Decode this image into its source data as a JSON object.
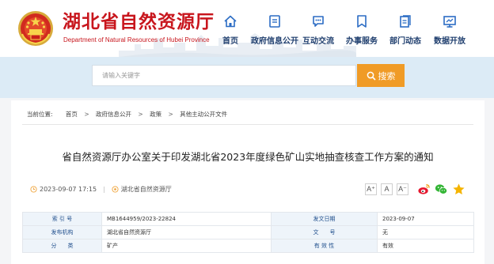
{
  "site": {
    "title": "湖北省自然资源厅",
    "subtitle": "Department of Natural Resources of Hubei Province"
  },
  "nav": [
    {
      "label": "首页",
      "icon": "home-icon"
    },
    {
      "label": "政府信息公开",
      "icon": "document-icon"
    },
    {
      "label": "互动交流",
      "icon": "chat-icon"
    },
    {
      "label": "办事服务",
      "icon": "bookmark-icon"
    },
    {
      "label": "部门动态",
      "icon": "news-icon"
    },
    {
      "label": "数据开放",
      "icon": "monitor-icon"
    }
  ],
  "search": {
    "placeholder": "请输入关键字",
    "button_label": "搜索"
  },
  "breadcrumb": {
    "prefix": "当前位置:",
    "items": [
      "首页",
      "政府信息公开",
      "政策",
      "其他主动公开文件"
    ]
  },
  "article": {
    "title": "省自然资源厅办公室关于印发湖北省2023年度绿色矿山实地抽查核查工作方案的通知",
    "datetime": "2023-09-07 17:15",
    "source": "湖北省自然资源厅"
  },
  "font_sizes": [
    "A⁺",
    "A",
    "A⁻"
  ],
  "share": [
    "weibo-icon",
    "wechat-icon",
    "favorite-star-icon"
  ],
  "info": {
    "rows": [
      [
        {
          "label": "索 引 号",
          "value": "MB1644959/2023-22824"
        },
        {
          "label": "发文日期",
          "value": "2023-09-07"
        }
      ],
      [
        {
          "label": "发布机构",
          "value": "湖北省自然资源厅"
        },
        {
          "label": "文　　号",
          "value": "无"
        }
      ],
      [
        {
          "label": "分　　类",
          "value": "矿产"
        },
        {
          "label": "有 效 性",
          "value": "有效"
        }
      ]
    ]
  },
  "colors": {
    "brand_red": "#c8161d",
    "nav_blue": "#1f3e6e",
    "search_orange": "#f09b26",
    "band_blue": "#dcebf6"
  }
}
